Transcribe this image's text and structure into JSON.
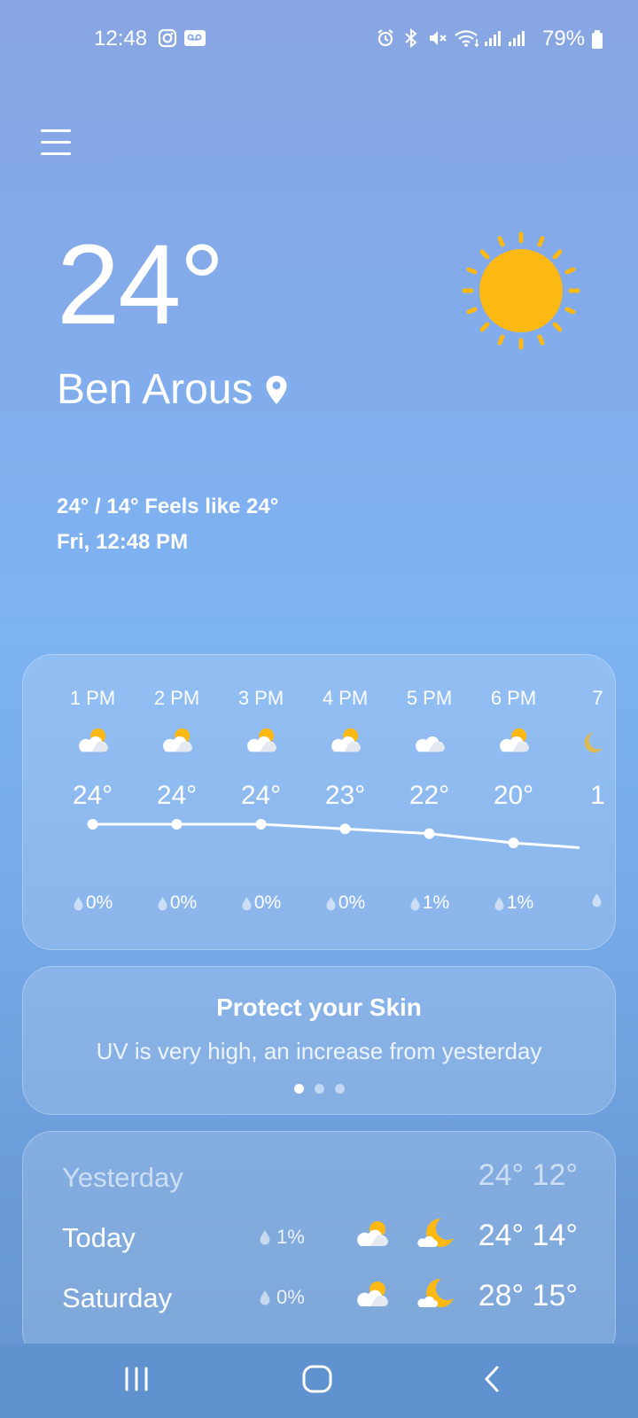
{
  "status_bar": {
    "time": "12:48",
    "battery": "79%",
    "icons": [
      "instagram-icon",
      "voicemail-icon",
      "alarm-icon",
      "bluetooth-icon",
      "mute-icon",
      "wifi-icon",
      "signal-icon",
      "signal-icon",
      "battery-icon"
    ]
  },
  "current": {
    "temperature": "24°",
    "location": "Ben Arous",
    "hi_lo_feels": "24° / 14° Feels like 24°",
    "datetime": "Fri, 12:48 PM",
    "condition_icon": "sun-icon"
  },
  "hourly": [
    {
      "hour": "1 PM",
      "temp": "24°",
      "rain": "0%",
      "icon": "partly-cloudy-icon",
      "value": 24
    },
    {
      "hour": "2 PM",
      "temp": "24°",
      "rain": "0%",
      "icon": "partly-cloudy-icon",
      "value": 24
    },
    {
      "hour": "3 PM",
      "temp": "24°",
      "rain": "0%",
      "icon": "partly-cloudy-icon",
      "value": 24
    },
    {
      "hour": "4 PM",
      "temp": "23°",
      "rain": "0%",
      "icon": "partly-cloudy-icon",
      "value": 23
    },
    {
      "hour": "5 PM",
      "temp": "22°",
      "rain": "1%",
      "icon": "cloud-icon",
      "value": 22
    },
    {
      "hour": "6 PM",
      "temp": "20°",
      "rain": "1%",
      "icon": "partly-cloudy-icon",
      "value": 20
    },
    {
      "hour": "7",
      "temp": "1",
      "rain": "",
      "icon": "moon-icon",
      "value": 19
    }
  ],
  "uv_card": {
    "title": "Protect your Skin",
    "subtitle": "UV is very high, an increase from yesterday",
    "page": 1,
    "pages": 3
  },
  "daily": [
    {
      "day": "Yesterday",
      "temps": "24° 12°"
    },
    {
      "day": "Today",
      "rain": "1%",
      "temps": "24° 14°",
      "day_icon": "partly-cloudy-icon",
      "night_icon": "moon-cloud-icon"
    },
    {
      "day": "Saturday",
      "rain": "0%",
      "temps": "28° 15°",
      "day_icon": "partly-cloudy-icon",
      "night_icon": "moon-cloud-icon"
    }
  ],
  "colors": {
    "sun": "#FDB913",
    "background_top": "#88A6E2",
    "background_bottom": "#6495D2"
  }
}
